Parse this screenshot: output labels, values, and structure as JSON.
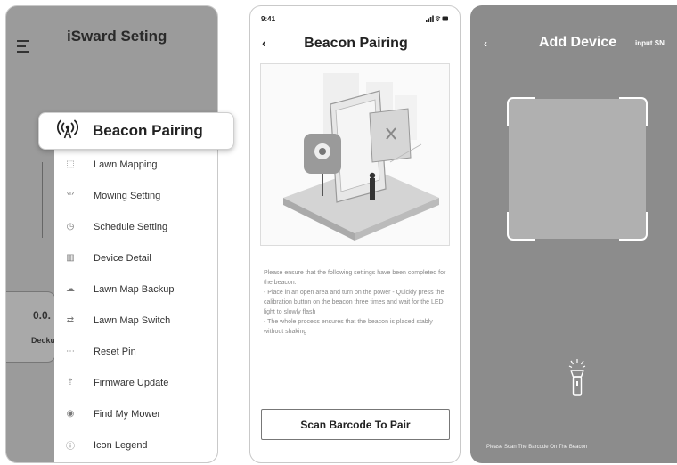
{
  "panel1": {
    "drawer_title": "iSward Seting",
    "highlight": {
      "label": "Beacon Pairing",
      "icon": "beacon-icon"
    },
    "menu": [
      {
        "label": "Lawn Mapping",
        "icon": "map-icon",
        "glyph": "⬚"
      },
      {
        "label": "Mowing Setting",
        "icon": "grass-icon",
        "glyph": "⺌"
      },
      {
        "label": "Schedule Setting",
        "icon": "clock-icon",
        "glyph": "◷"
      },
      {
        "label": "Device Detail",
        "icon": "chart-icon",
        "glyph": "▥"
      },
      {
        "label": "Lawn Map Backup",
        "icon": "cloud-icon",
        "glyph": "☁"
      },
      {
        "label": "Lawn Map Switch",
        "icon": "switch-icon",
        "glyph": "⇄"
      },
      {
        "label": "Reset Pin",
        "icon": "pin-icon",
        "glyph": "⋯"
      },
      {
        "label": "Firmware Update",
        "icon": "upload-icon",
        "glyph": "⇡"
      },
      {
        "label": "Find My Mower",
        "icon": "location-icon",
        "glyph": "◉"
      },
      {
        "label": "Icon Legend",
        "icon": "info-icon",
        "glyph": "ⓘ"
      }
    ],
    "background": {
      "value": "0.0.",
      "label": "Deckur"
    }
  },
  "panel2": {
    "status_time": "9:41",
    "back": "‹",
    "title": "Beacon Pairing",
    "instructions": [
      "Please ensure that the following settings have been completed for the beacon:",
      "- Place in an open area and turn on the power - Quickly press the calibration button on the beacon three times and wait for the LED light to slowly flash",
      "- The whole process ensures that the beacon is placed stably without shaking"
    ],
    "button": "Scan Barcode To Pair"
  },
  "panel3": {
    "back": "‹",
    "title": "Add Device",
    "input_sn": "input SN",
    "hint": "Please Scan The Barcode On The Beacon"
  }
}
